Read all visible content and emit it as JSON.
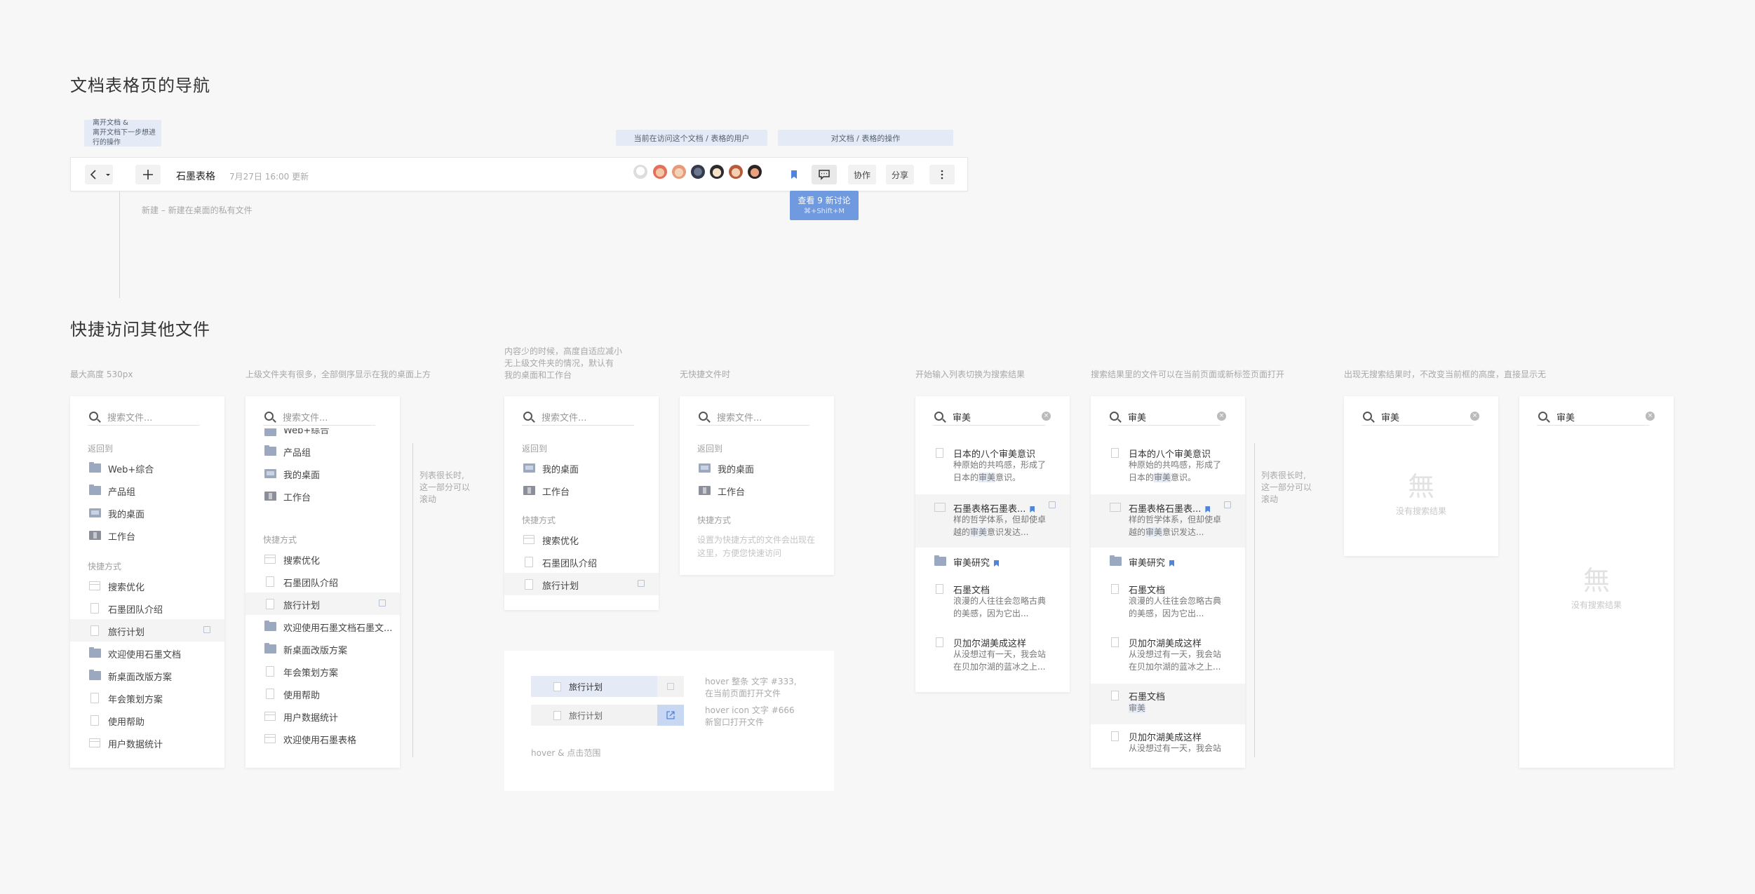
{
  "section1": {
    "title": "文档表格页的导航",
    "tag_leave": [
      "离开文档 &",
      "离开文档下一步想进行的操作"
    ],
    "tag_users": "当前在访问这个文档 / 表格的用户",
    "tag_ops": "对文档 / 表格的操作",
    "new_note": "新建 – 新建在桌面的私有文件",
    "toolbar": {
      "doc_title": "石墨表格",
      "updated": "7月27日 16:00 更新",
      "collab": "协作",
      "share": "分享"
    },
    "tooltip": {
      "title": "查看 9 新讨论",
      "shortcut": "⌘+Shift+M"
    }
  },
  "section2": {
    "title": "快捷访问其他文件",
    "notes": {
      "p1": "最大高度 530px",
      "p2": "上级文件夹有很多，全部倒序显示在我的桌面上方",
      "p3a": "内容少的时候，高度自适应减小",
      "p3b": "无上级文件夹的情况，默认有",
      "p3c": "我的桌面和工作台",
      "p4": "无快捷文件时",
      "p5": "开始输入列表切换为搜索结果",
      "p6": "搜索结果里的文件可以在当前页面或新标签页面打开",
      "p7": "出现无搜索结果时，不改变当前框的高度，直接显示无",
      "scroll_a": "列表很长时,",
      "scroll_b": "这一部分可以",
      "scroll_c": "滚动"
    },
    "placeholder": "搜索文件...",
    "query": "审美",
    "back_to": "返回到",
    "shortcuts": "快捷方式",
    "no_shortcut": [
      "设置为快捷方式的文件会出现在",
      "这里，方便您快速访问"
    ],
    "no_result_glyph": "無",
    "no_result": "没有搜索结果",
    "panel1_back": [
      "Web+综合",
      "产品组",
      "我的桌面",
      "工作台"
    ],
    "panel1_short": [
      "搜索优化",
      "石墨团队介绍",
      "旅行计划",
      "欢迎使用石墨文档",
      "新桌面改版方案",
      "年会策划方案",
      "使用帮助",
      "用户数据统计"
    ],
    "panel2_back": [
      "Web+综合",
      "产品组",
      "我的桌面",
      "工作台"
    ],
    "panel2_short": [
      "搜索优化",
      "石墨团队介绍",
      "旅行计划",
      "欢迎使用石墨文档石墨文...",
      "新桌面改版方案",
      "年会策划方案",
      "使用帮助",
      "用户数据统计",
      "欢迎使用石墨表格"
    ],
    "panel3_back": [
      "我的桌面",
      "工作台"
    ],
    "panel3_short": [
      "搜索优化",
      "石墨团队介绍",
      "旅行计划"
    ],
    "hover_demo": {
      "item": "旅行计划",
      "note1a": "hover 整条 文字 #333,",
      "note1b": "在当前页面打开文件",
      "note2a": "hover icon 文字 #666",
      "note2b": "新窗口打开文件",
      "caption": "hover & 点击范围"
    },
    "results": [
      {
        "title": "日本的八个审美意识",
        "desc": "种原始的共鸣感，形成了日本的审美意识。"
      },
      {
        "title": "石墨表格石墨表...",
        "desc": "样的哲学体系，但却使卓越的审美意识发达..."
      },
      {
        "title": "审美研究",
        "desc": ""
      },
      {
        "title": "石墨文档",
        "desc": "浪漫的人往往会忽略古典的美感，因为它出..."
      },
      {
        "title": "贝加尔湖美成这样",
        "desc": "从没想过有一天，我会站在贝加尔湖的蓝冰之上..."
      }
    ],
    "results_extra": [
      {
        "title": "石墨文档",
        "desc": "审美"
      },
      {
        "title": "贝加尔湖美成这样",
        "desc": "从没想过有一天，我会站"
      }
    ]
  },
  "colors": {
    "accent": "#4f84db",
    "tag_bg": "#e4ebf7",
    "tooltip_bg": "#6f9ae0"
  }
}
